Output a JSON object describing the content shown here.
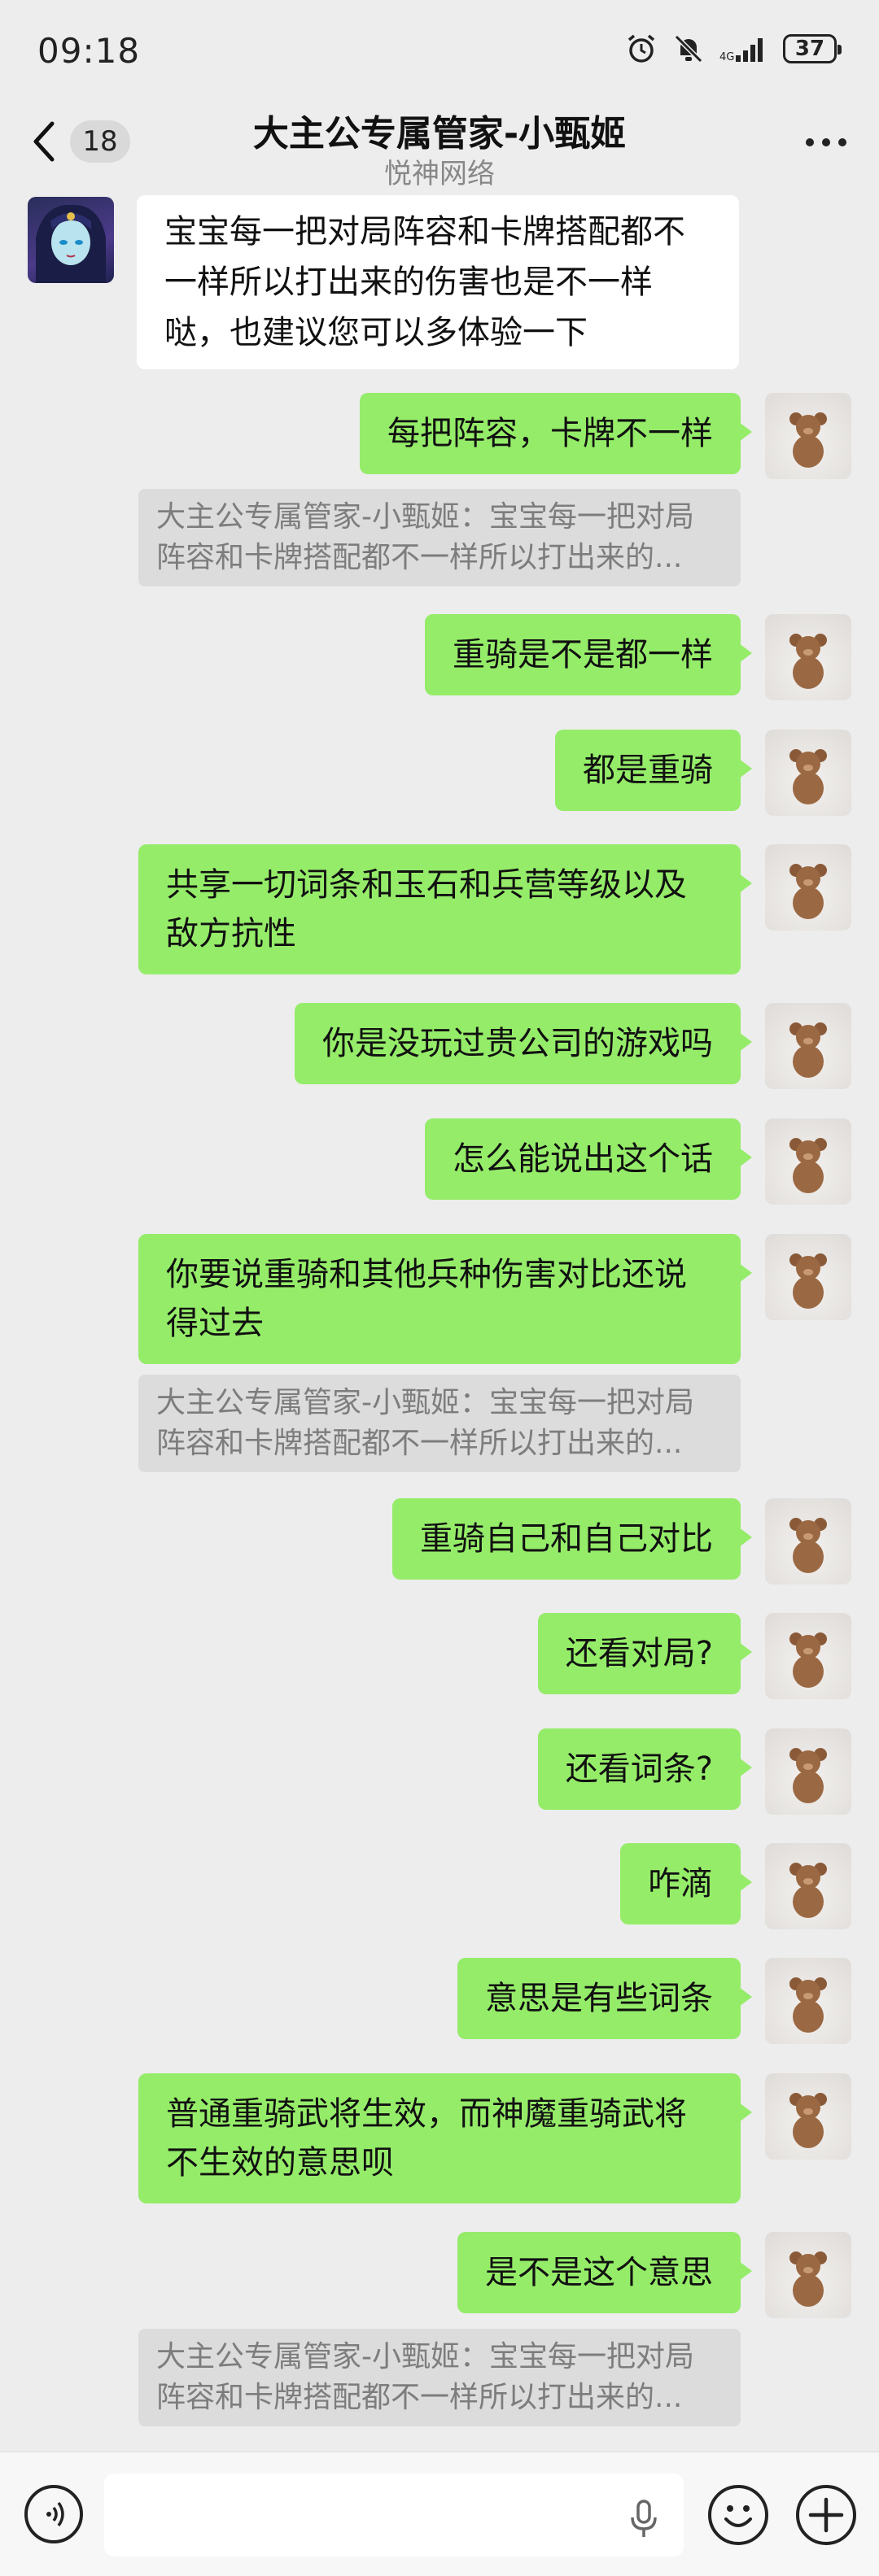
{
  "status": {
    "time": "09:18",
    "battery": "37",
    "network_small": "4G"
  },
  "header": {
    "unread_count": "18",
    "title": "大主公专属管家-小甄姬",
    "subtitle": "悦神网络"
  },
  "messages": [
    {
      "from": "them",
      "text": "宝宝每一把对局阵容和卡牌搭配都不一样所以打出来的伤害也是不一样哒，也建议您可以多体验一下"
    },
    {
      "from": "me",
      "text": "每把阵容，卡牌不一样"
    },
    {
      "from": "quote",
      "text": "大主公专属管家-小甄姬：宝宝每一把对局阵容和卡牌搭配都不一样所以打出来的..."
    },
    {
      "from": "me",
      "text": "重骑是不是都一样"
    },
    {
      "from": "me",
      "text": "都是重骑"
    },
    {
      "from": "me",
      "text": "共享一切词条和玉石和兵营等级以及敌方抗性"
    },
    {
      "from": "me",
      "text": "你是没玩过贵公司的游戏吗"
    },
    {
      "from": "me",
      "text": "怎么能说出这个话"
    },
    {
      "from": "me",
      "text": "你要说重骑和其他兵种伤害对比还说得过去"
    },
    {
      "from": "quote",
      "text": "大主公专属管家-小甄姬：宝宝每一把对局阵容和卡牌搭配都不一样所以打出来的..."
    },
    {
      "from": "me",
      "text": "重骑自己和自己对比"
    },
    {
      "from": "me",
      "text": "还看对局?"
    },
    {
      "from": "me",
      "text": "还看词条?"
    },
    {
      "from": "me",
      "text": "咋滴"
    },
    {
      "from": "me",
      "text": "意思是有些词条"
    },
    {
      "from": "me",
      "text": "普通重骑武将生效，而神魔重骑武将不生效的意思呗"
    },
    {
      "from": "me",
      "text": "是不是这个意思"
    },
    {
      "from": "quote",
      "text": "大主公专属管家-小甄姬：宝宝每一把对局阵容和卡牌搭配都不一样所以打出来的..."
    }
  ],
  "icons": {
    "back": "chevron-left-icon",
    "more": "more-dots-icon",
    "voice": "voice-icon",
    "mic": "mic-icon",
    "emoji": "emoji-icon",
    "add": "plus-icon",
    "alarm": "alarm-icon",
    "mute": "bell-off-icon",
    "signal": "signal-icon"
  },
  "colors": {
    "outgoing_bubble": "#95ec69",
    "incoming_bubble": "#ffffff",
    "background": "#ededed",
    "quote_bg": "#dcdcdc"
  }
}
